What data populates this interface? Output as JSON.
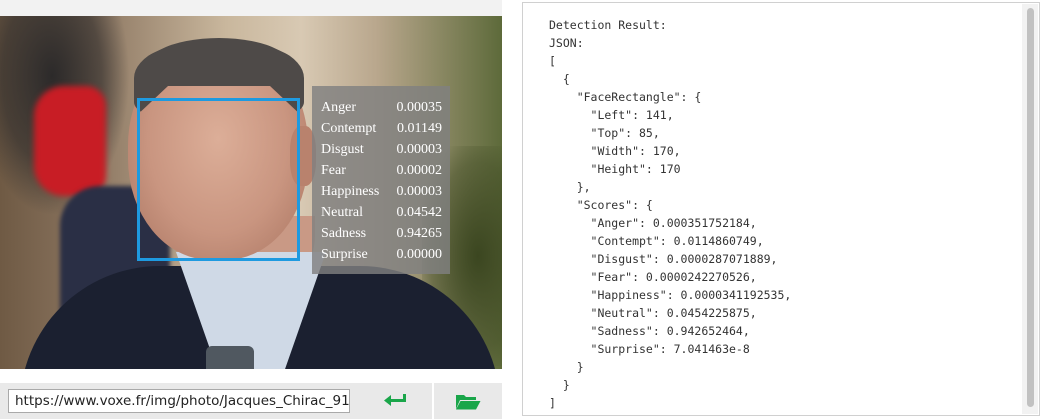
{
  "image": {
    "scores": [
      {
        "label": "Anger",
        "value": "0.00035"
      },
      {
        "label": "Contempt",
        "value": "0.01149"
      },
      {
        "label": "Disgust",
        "value": "0.00003"
      },
      {
        "label": "Fear",
        "value": "0.00002"
      },
      {
        "label": "Happiness",
        "value": "0.00003"
      },
      {
        "label": "Neutral",
        "value": "0.04542"
      },
      {
        "label": "Sadness",
        "value": "0.94265"
      },
      {
        "label": "Surprise",
        "value": "0.00000"
      }
    ]
  },
  "url_bar": {
    "value": "https://www.voxe.fr/img/photo/Jacques_Chirac_91",
    "enter_icon": "enter-arrow-icon",
    "folder_icon": "folder-open-icon"
  },
  "result": {
    "lines": [
      "Detection Result:",
      "JSON:",
      "[",
      "  {",
      "    \"FaceRectangle\": {",
      "      \"Left\": 141,",
      "      \"Top\": 85,",
      "      \"Width\": 170,",
      "      \"Height\": 170",
      "    },",
      "    \"Scores\": {",
      "      \"Anger\": 0.000351752184,",
      "      \"Contempt\": 0.0114860749,",
      "      \"Disgust\": 0.0000287071889,",
      "      \"Fear\": 0.0000242270526,",
      "      \"Happiness\": 0.0000341192535,",
      "      \"Neutral\": 0.0454225875,",
      "      \"Sadness\": 0.942652464,",
      "      \"Surprise\": 7.041463e-8",
      "    }",
      "  }",
      "]"
    ]
  },
  "colors": {
    "face_box": "#1e9ae0",
    "accent": "#1aa64a"
  }
}
